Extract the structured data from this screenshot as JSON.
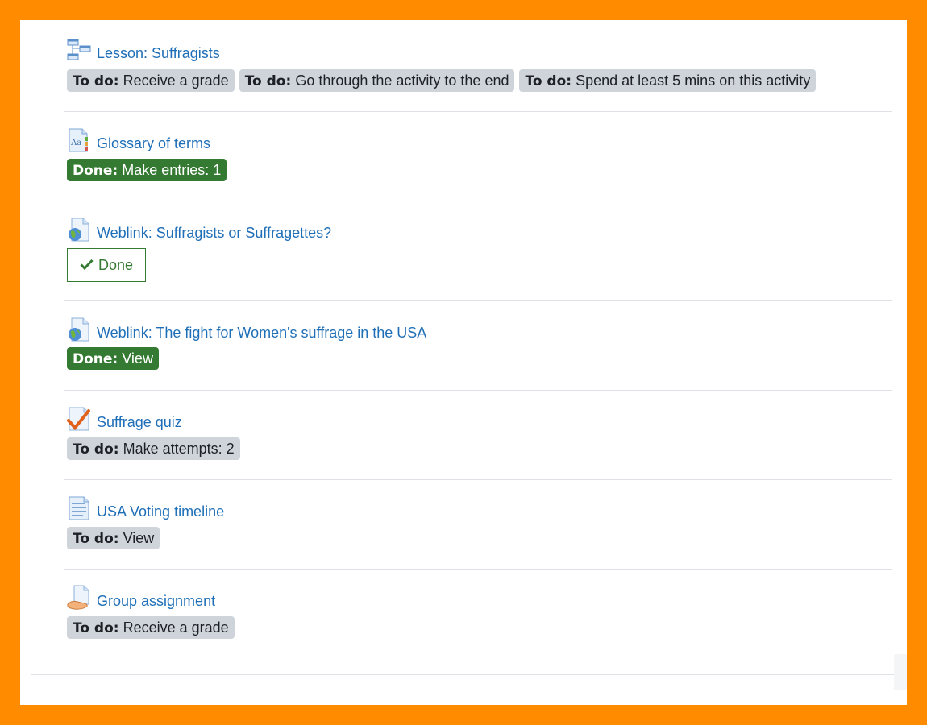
{
  "activities": [
    {
      "icon": "lesson-icon",
      "title": "Lesson: Suffragists",
      "badges": [
        {
          "prefix": "To do:",
          "text": "Receive a grade"
        },
        {
          "prefix": "To do:",
          "text": "Go through the activity to the end"
        },
        {
          "prefix": "To do:",
          "text": "Spend at least 5 mins on this activity"
        }
      ]
    },
    {
      "icon": "glossary-icon",
      "title": "Glossary of terms",
      "badges": [
        {
          "prefix": "Done:",
          "text": "Make entries: 1"
        }
      ]
    },
    {
      "icon": "url-globe-icon",
      "title": "Weblink: Suffragists or Suffragettes?",
      "done_button": {
        "icon": "check-icon",
        "label": "Done"
      }
    },
    {
      "icon": "url-globe-icon",
      "title": "Weblink: The fight for Women's suffrage in the USA",
      "badges": [
        {
          "prefix": "Done:",
          "text": "View"
        }
      ]
    },
    {
      "icon": "quiz-icon",
      "title": "Suffrage quiz",
      "badges": [
        {
          "prefix": "To do:",
          "text": "Make attempts: 2"
        }
      ]
    },
    {
      "icon": "page-icon",
      "title": "USA Voting timeline",
      "badges": [
        {
          "prefix": "To do:",
          "text": "View"
        }
      ]
    },
    {
      "icon": "assignment-icon",
      "title": "Group assignment",
      "badges": [
        {
          "prefix": "To do:",
          "text": "Receive a grade"
        }
      ]
    }
  ],
  "colors": {
    "frame": "#ff8c00",
    "link": "#1f6fb8",
    "todo_badge": "#ced4da",
    "done_badge": "#357a32"
  }
}
